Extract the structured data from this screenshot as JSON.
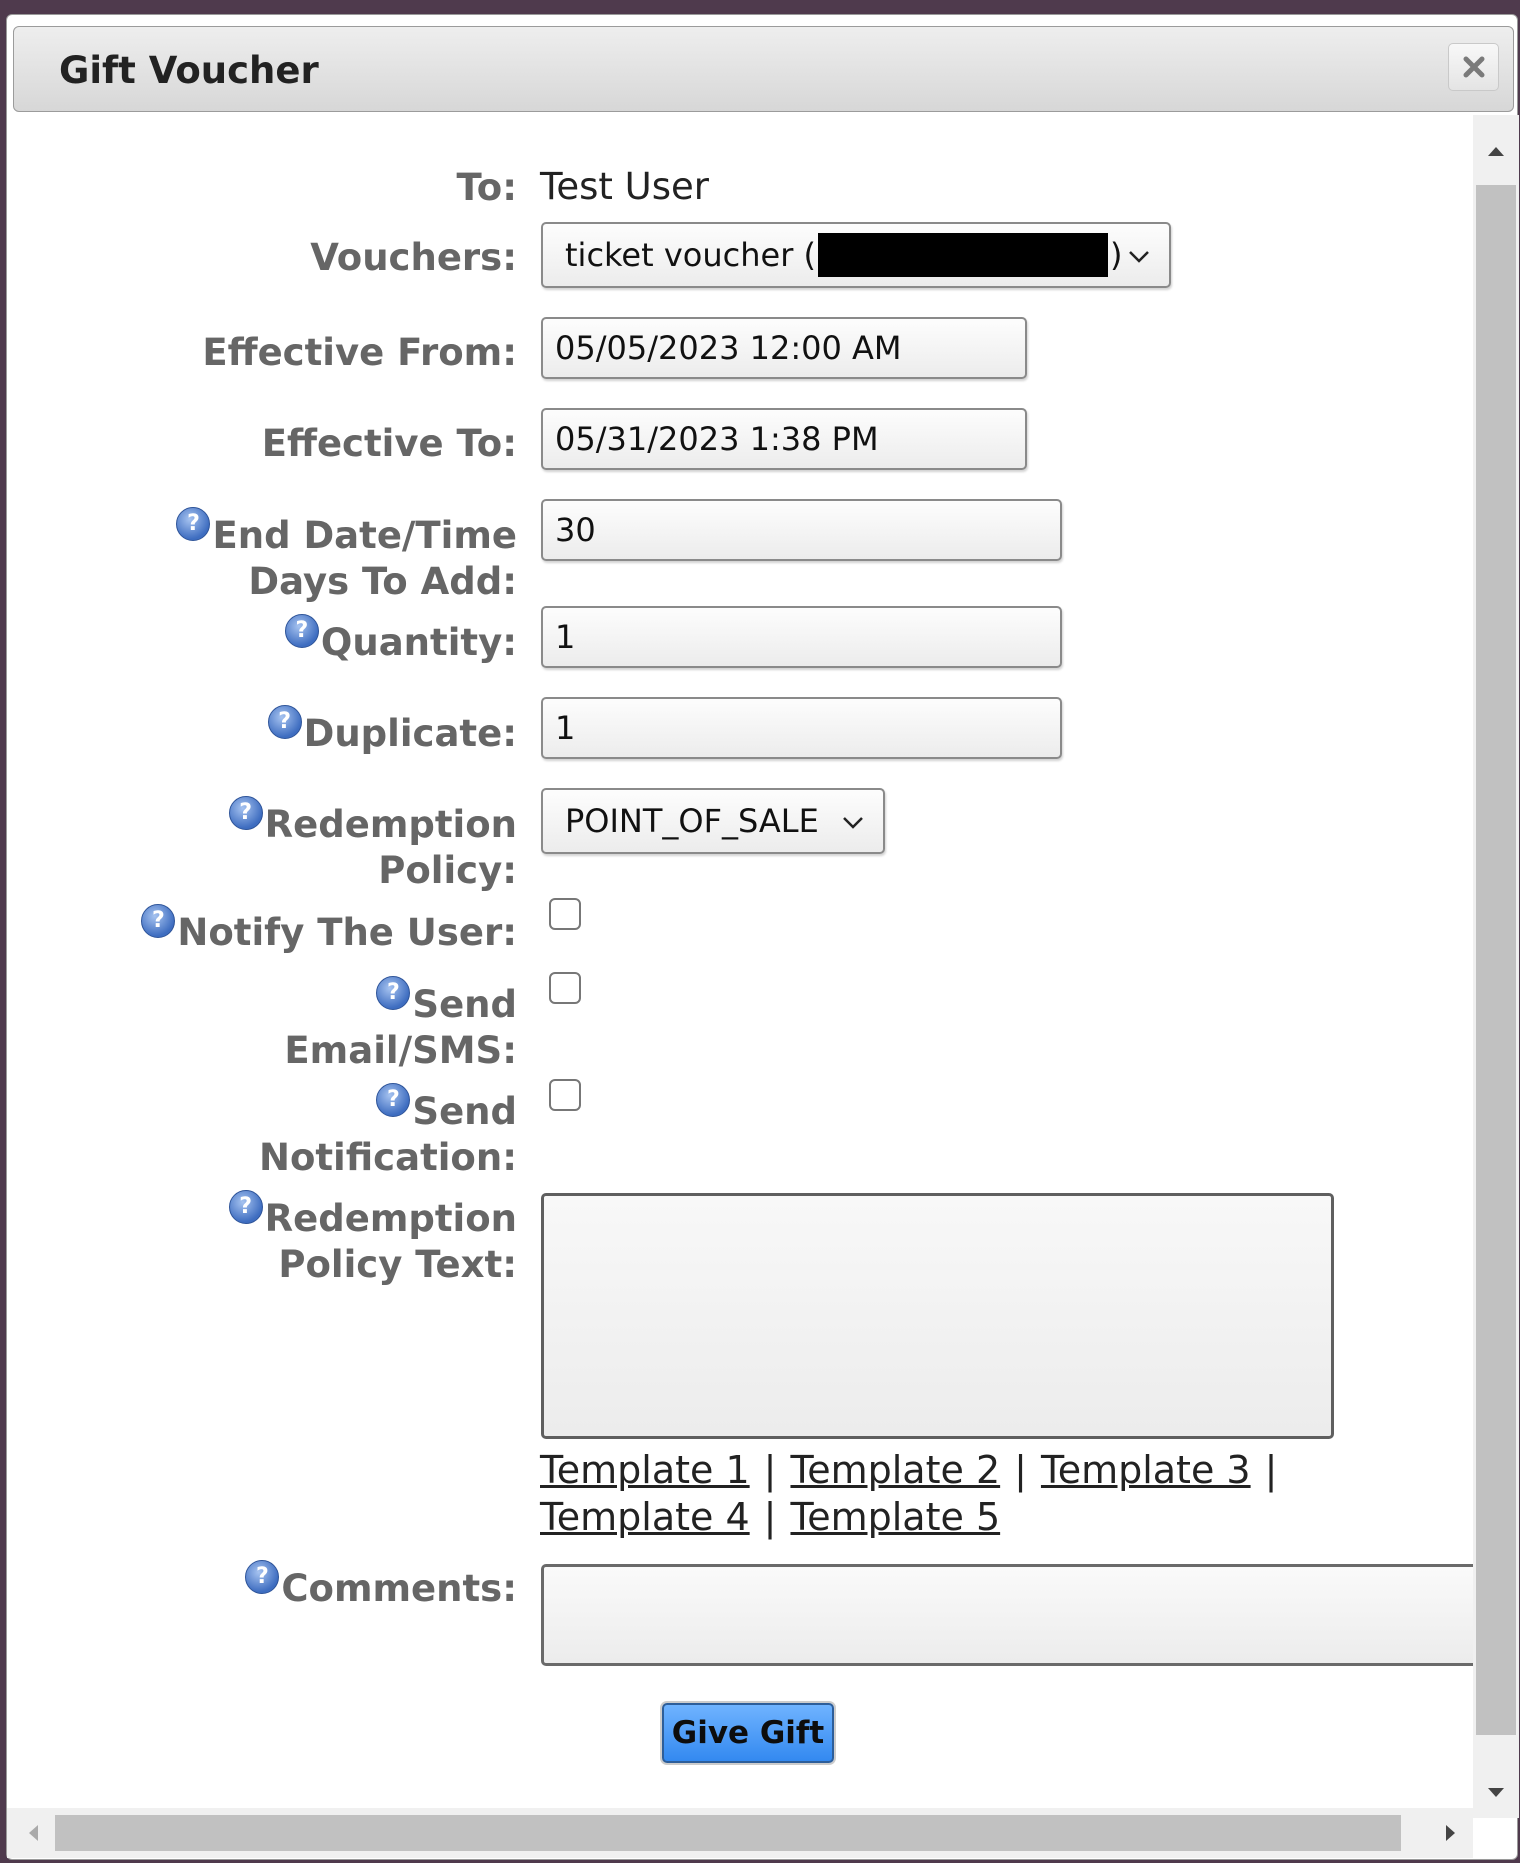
{
  "dialog": {
    "title": "Gift Voucher"
  },
  "labels": {
    "to": "To:",
    "vouchers": "Vouchers:",
    "effective_from": "Effective From:",
    "effective_to": "Effective To:",
    "end_date_line1": "End Date/Time",
    "end_date_line2": "Days To Add:",
    "quantity": "Quantity:",
    "duplicate": "Duplicate:",
    "redemption_policy_line1": "Redemption",
    "redemption_policy_line2": "Policy:",
    "notify_user": "Notify The User:",
    "send_email_line1": "Send",
    "send_email_line2": "Email/SMS:",
    "send_notification_line1": "Send",
    "send_notification_line2": "Notification:",
    "policy_text_line1": "Redemption",
    "policy_text_line2": "Policy Text:",
    "comments": "Comments:"
  },
  "form": {
    "to_value": "Test User",
    "voucher_prefix": "ticket voucher (",
    "voucher_suffix": ")",
    "effective_from": "05/05/2023 12:00 AM",
    "effective_to": "05/31/2023 1:38 PM",
    "days_to_add": "30",
    "quantity": "1",
    "duplicate": "1",
    "redemption_policy": "POINT_OF_SALE",
    "notify_user_checked": false,
    "send_email_checked": false,
    "send_notification_checked": false,
    "policy_text": "",
    "comments": ""
  },
  "templates": [
    "Template 1",
    "Template 2",
    "Template 3",
    "Template 4",
    "Template 5"
  ],
  "template_separator": "|",
  "buttons": {
    "give_gift": "Give Gift"
  },
  "colors": {
    "backdrop": "#4f3a4d",
    "primary_button": "#3389f0",
    "label_text": "#666666",
    "help_icon": "#3e6dc0"
  },
  "icons": {
    "close": "close-icon",
    "help": "help-icon",
    "dropdown": "chevron-down-icon"
  }
}
